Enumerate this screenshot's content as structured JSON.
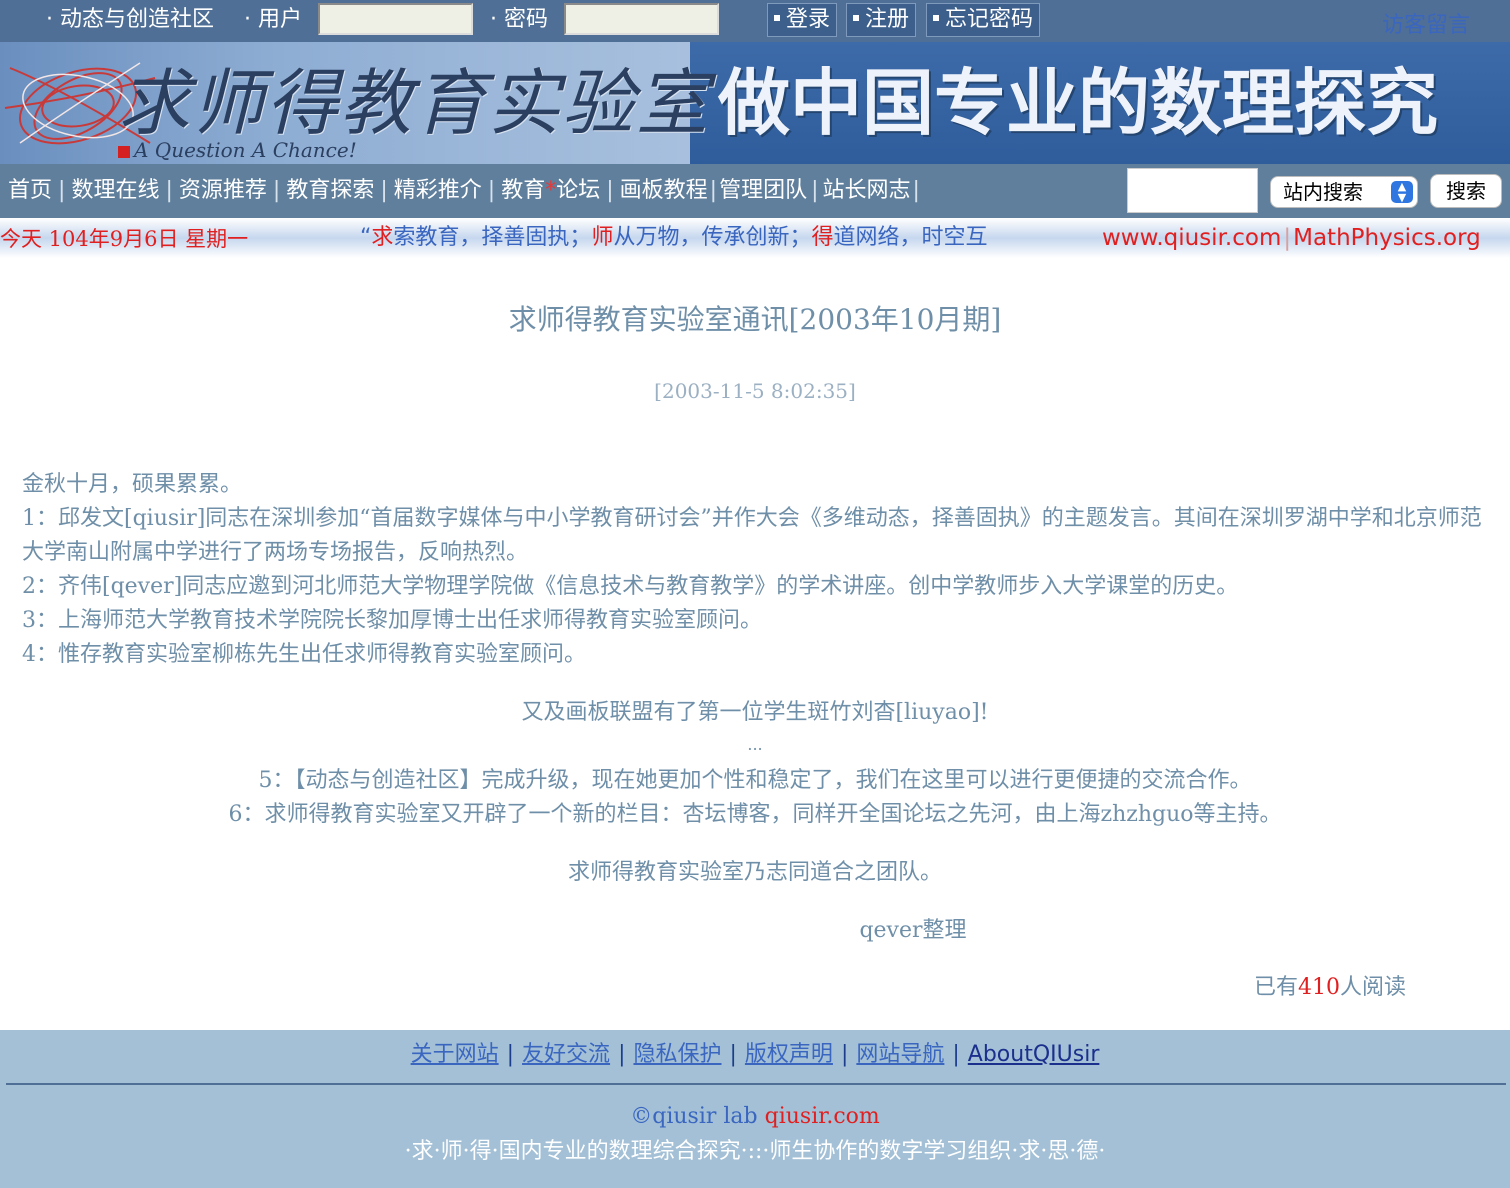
{
  "topbar": {
    "community": "· 动态与创造社区",
    "user_label": "· 用户",
    "user_value": "",
    "password_label": "· 密码",
    "password_value": "",
    "login": "登录",
    "register": "注册",
    "forgot": "忘记密码",
    "guestbook": "访客留言"
  },
  "banner": {
    "title": "求师得教育实验室",
    "subtitle": "A Question A Chance!",
    "slogan": "做中国专业的数理探究"
  },
  "nav": {
    "items": [
      "首页",
      "数理在线",
      "资源推荐",
      "教育探索",
      "精彩推介",
      "教育",
      "论坛",
      "画板教程",
      "管理团队",
      "站长网志"
    ],
    "star": "*",
    "search_placeholder": "",
    "search_scope": "站内搜索",
    "search_button": "搜索"
  },
  "ticker": {
    "date": "今天 104年9月6日 星期一",
    "quote_open": "“",
    "p1_red": "求",
    "p1": "索教育，择善固执；",
    "p2_red": "师",
    "p2": "从万物，传承创新；",
    "p3_red": "得",
    "p3": "道网络，时空互",
    "url1": "www.qiusir.com",
    "url_sep": "|",
    "url2": "MathPhysics.org"
  },
  "article": {
    "title": "求师得教育实验室通讯[2003年10月期]",
    "time": "[2003-11-5 8:02:35]",
    "intro": "金秋十月，硕果累累。",
    "p1": "1：邱发文[qiusir]同志在深圳参加“首届数字媒体与中小学教育研讨会”并作大会《多维动态，择善固执》的主题发言。其间在深圳罗湖中学和北京师范大学南山附属中学进行了两场专场报告，反响热烈。",
    "p2": "2：齐伟[qever]同志应邀到河北师范大学物理学院做《信息技术与教育教学》的学术讲座。创中学教师步入大学课堂的历史。",
    "p3": "3：上海师范大学教育技术学院院长黎加厚博士出任求师得教育实验室顾问。",
    "p4": "4：惟存教育实验室柳栋先生出任求师得教育实验室顾问。",
    "c1": "又及画板联盟有了第一位学生斑竹刘杳[liuyao]!",
    "c2": "...",
    "p5": "5：【动态与创造社区】完成升级，现在她更加个性和稳定了，我们在这里可以进行更便捷的交流合作。",
    "p6": "6：求师得教育实验室又开辟了一个新的栏目：杏坛博客，同样开全国论坛之先河，由上海zhzhguo等主持。",
    "c3": "求师得教育实验室乃志同道合之团队。",
    "sign": "qever整理",
    "reads_pre": "已有",
    "reads_num": "410",
    "reads_post": "人阅读"
  },
  "footer": {
    "links": [
      "关于网站",
      "友好交流",
      "隐私保护",
      "版权声明",
      "网站导航",
      "AboutQIUsir"
    ],
    "sep": "|",
    "copy_pre": "©qiusir lab",
    "copy_site": "qiusir.com",
    "motto": "·求·师·得·国内专业的数理综合探究·::·师生协作的数字学习组织·求·思·德·"
  },
  "colors": {
    "topbar": "#4f6f96",
    "nav": "#5f7f9c",
    "text": "#6f8fa8",
    "accent_red": "#e02020",
    "footer": "#a3c0d6"
  }
}
